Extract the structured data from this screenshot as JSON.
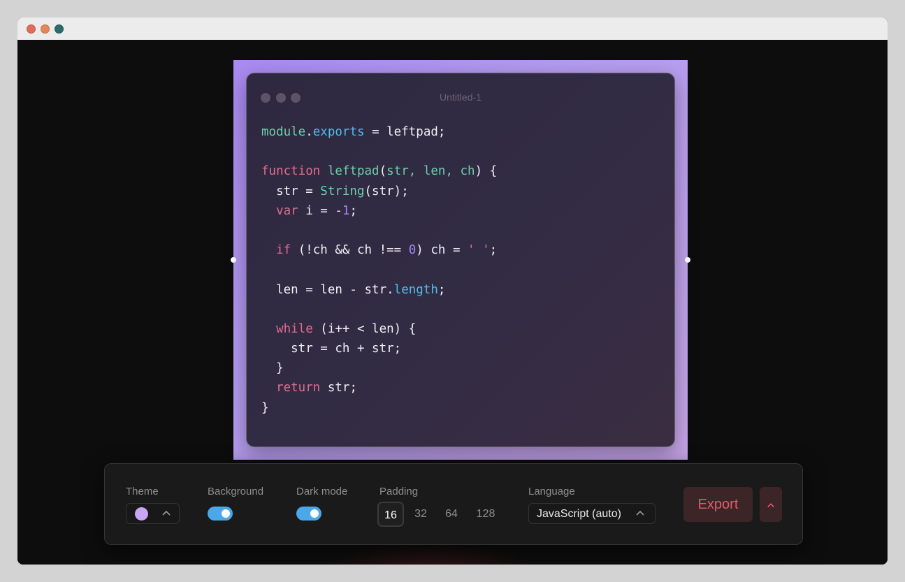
{
  "window": {
    "traffic_lights": [
      "close",
      "minimize",
      "maximize"
    ]
  },
  "editor": {
    "title": "Untitled-1",
    "code_lines": [
      [
        [
          "f",
          "module"
        ],
        [
          "",
          "."
        ],
        [
          "p",
          "exports"
        ],
        [
          "",
          " = leftpad;"
        ]
      ],
      [],
      [
        [
          "k",
          "function"
        ],
        [
          "",
          " "
        ],
        [
          "f",
          "leftpad"
        ],
        [
          "",
          "("
        ],
        [
          "f",
          "str, len, ch"
        ],
        [
          "",
          ") {"
        ]
      ],
      [
        [
          "",
          "  str = "
        ],
        [
          "f",
          "String"
        ],
        [
          "",
          "(str);"
        ]
      ],
      [
        [
          "",
          "  "
        ],
        [
          "k",
          "var"
        ],
        [
          "",
          " i = -"
        ],
        [
          "n",
          "1"
        ],
        [
          "",
          ";"
        ]
      ],
      [],
      [
        [
          "",
          "  "
        ],
        [
          "k",
          "if"
        ],
        [
          "",
          " (!ch && ch !== "
        ],
        [
          "n",
          "0"
        ],
        [
          "",
          ") ch = "
        ],
        [
          "s",
          "' '"
        ],
        [
          "",
          ";"
        ]
      ],
      [],
      [
        [
          "",
          "  len = len - str."
        ],
        [
          "p",
          "length"
        ],
        [
          "",
          ";"
        ]
      ],
      [],
      [
        [
          "",
          "  "
        ],
        [
          "k",
          "while"
        ],
        [
          "",
          " (i++ < len) {"
        ]
      ],
      [
        [
          "",
          "    str = ch + str;"
        ]
      ],
      [
        [
          "",
          "  }"
        ]
      ],
      [
        [
          "",
          "  "
        ],
        [
          "k",
          "return"
        ],
        [
          "",
          " str;"
        ]
      ],
      [
        [
          "",
          "}"
        ]
      ]
    ]
  },
  "toolbar": {
    "theme": {
      "label": "Theme",
      "swatch_color": "#c9a6f2",
      "icon": "chevron-up-icon"
    },
    "background": {
      "label": "Background",
      "enabled": true
    },
    "dark_mode": {
      "label": "Dark mode",
      "enabled": true
    },
    "padding": {
      "label": "Padding",
      "options": [
        "16",
        "32",
        "64",
        "128"
      ],
      "selected": "16"
    },
    "language": {
      "label": "Language",
      "value": "JavaScript (auto)",
      "icon": "chevron-up-icon"
    },
    "export": {
      "label": "Export",
      "more_icon": "chevron-up-icon"
    }
  },
  "colors": {
    "frame_gradient": [
      "#a98af2",
      "#c7a5e8"
    ],
    "toggle_on": "#4aa8e8",
    "export_text": "#e25c6e",
    "export_bg": "#3b2526",
    "keyword": "#e26d8f",
    "function": "#6dcfa9",
    "property": "#4fbde8",
    "number": "#9f8af0"
  }
}
